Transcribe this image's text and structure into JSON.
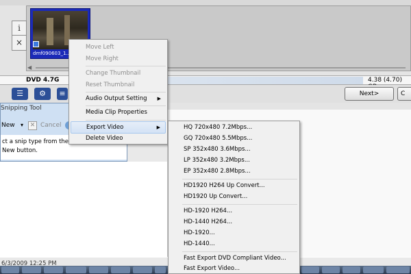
{
  "editor": {
    "info_button": "i",
    "close_button": "×",
    "clip": {
      "name": "dmf090603_1..."
    },
    "capacity_label": "DVD 4.7G",
    "capacity_used": "4.38 (4.70) GB",
    "next_label": "Next>",
    "next2_label": "C"
  },
  "snipping_tool": {
    "title": "Snipping Tool",
    "new_label": "New",
    "new_arrow": "▾",
    "cancel_label": "Cancel",
    "message_line1": "ct a snip type from the menu or click",
    "message_line2": "New button.",
    "info_icon": "i"
  },
  "timestamp": "6/3/2009 12:25 PM",
  "context_menu": {
    "items": [
      {
        "label": "Move Left",
        "enabled": false
      },
      {
        "label": "Move Right",
        "enabled": false
      },
      {
        "label": "Change Thumbnail",
        "enabled": false
      },
      {
        "label": "Reset Thumbnail",
        "enabled": false
      },
      {
        "label": "Audio Output Setting",
        "enabled": true,
        "submenu": true
      },
      {
        "label": "Media Clip Properties",
        "enabled": true
      },
      {
        "label": "Export Video",
        "enabled": true,
        "submenu": true,
        "highlighted": true
      },
      {
        "label": "Delete Video",
        "enabled": true
      }
    ],
    "submenu_arrow": "▶"
  },
  "export_submenu": {
    "items": [
      "HQ 720x480 7.2Mbps...",
      "GQ 720x480 5.5Mbps...",
      "SP 352x480 3.6Mbps...",
      "LP 352x480 3.2Mbps...",
      "EP 352x480 2.8Mbps...",
      "HD1920 H264 Up Convert...",
      "HD1920 Up Convert...",
      "HD-1920 H264...",
      "HD-1440 H264...",
      "HD-1920...",
      "HD-1440...",
      "Fast Export DVD Compliant Video...",
      "Fast Export Video..."
    ]
  }
}
